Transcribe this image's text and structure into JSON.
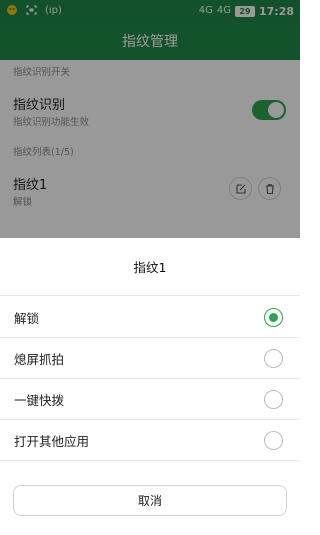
{
  "statusbar": {
    "network_badge": "(ıp)",
    "signal_1": "4G",
    "signal_2": "4G",
    "battery": "29",
    "time": "17:28"
  },
  "appbar": {
    "title": "指纹管理"
  },
  "settings": {
    "switch_section_label": "指纹识别开关",
    "fingerprint_recognition": {
      "title": "指纹识别",
      "subtitle": "指纹识别功能生效",
      "enabled": true
    },
    "list_section_label": "指纹列表(1/5)",
    "fingerprint_item": {
      "title": "指纹1",
      "subtitle": "解锁"
    }
  },
  "sheet": {
    "title": "指纹1",
    "options": [
      {
        "label": "解锁",
        "checked": true
      },
      {
        "label": "熄屏抓拍",
        "checked": false
      },
      {
        "label": "一键快拨",
        "checked": false
      },
      {
        "label": "打开其他应用",
        "checked": false
      }
    ],
    "cancel_label": "取消"
  },
  "colors": {
    "primary_green": "#1e8a4a",
    "accent_green": "#2ea34f"
  }
}
